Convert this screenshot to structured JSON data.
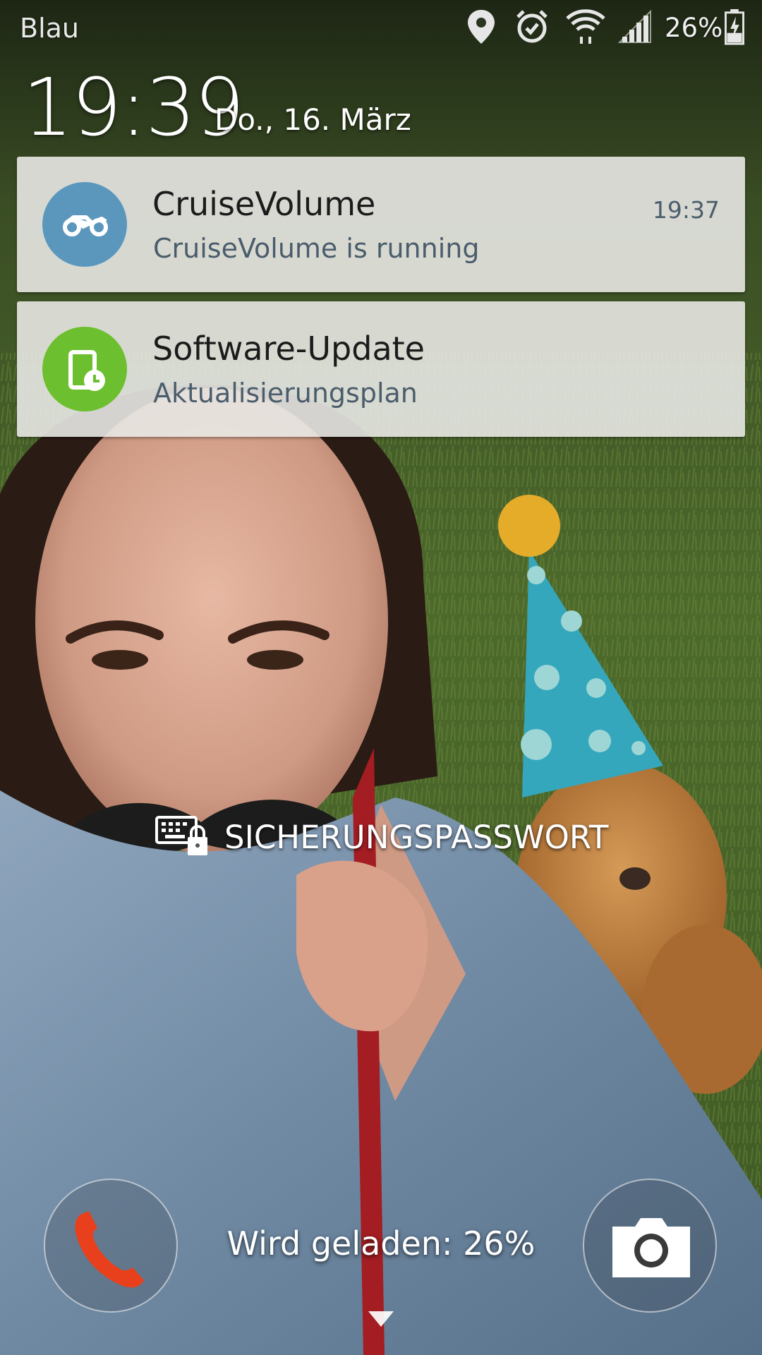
{
  "status_bar": {
    "carrier": "Blau",
    "battery_percent": "26%",
    "icons": [
      "location-icon",
      "alarm-icon",
      "wifi-icon",
      "signal-icon",
      "battery-charging-icon"
    ]
  },
  "lockscreen": {
    "time": "19:39",
    "date": "Do., 16. März"
  },
  "notifications": [
    {
      "icon": "motorcycle-icon",
      "icon_color": "#5b97bd",
      "title": "CruiseVolume",
      "text": "CruiseVolume is running",
      "time": "19:37"
    },
    {
      "icon": "software-update-icon",
      "icon_color": "#6cbf2e",
      "title": "Software-Update",
      "text": "Aktualisierungsplan"
    }
  ],
  "unlock": {
    "method_icon": "keyboard-lock-icon",
    "label": "SICHERUNGSPASSWORT"
  },
  "bottom": {
    "left_shortcut": "phone-icon",
    "right_shortcut": "camera-icon",
    "charging_text": "Wird geladen: 26%",
    "expand_icon": "arrow-down-icon"
  },
  "colors": {
    "phone_red": "#e8401c",
    "notification_bg": "#e8e8e4",
    "notification_subtext": "#4b5d6c"
  }
}
